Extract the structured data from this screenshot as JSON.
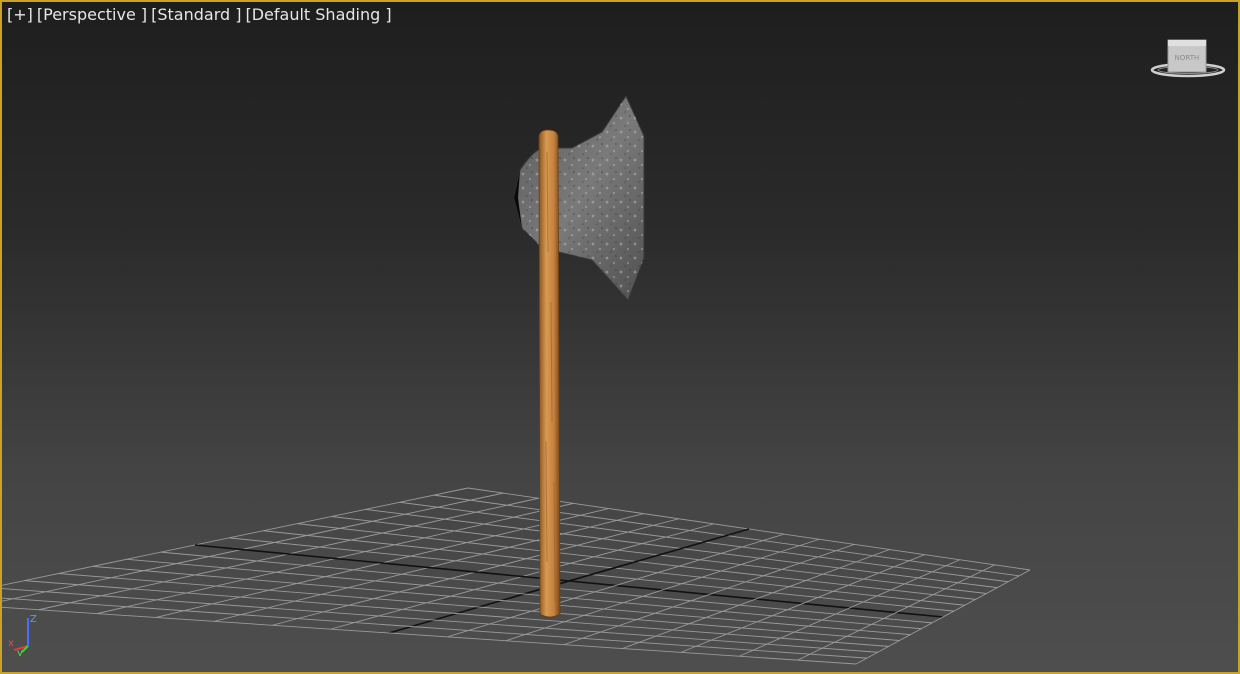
{
  "viewport": {
    "labels": {
      "menu": "[+]",
      "view": "[Perspective ]",
      "mode": "[Standard ]",
      "shading": "[Default Shading ]"
    },
    "active_border_color": "#c9a227",
    "viewcube": {
      "face_label": "NORTH",
      "icon": "viewcube-icon"
    },
    "axis_tripod": {
      "z_label": "Z",
      "x_label": "x",
      "y_label": "y"
    }
  },
  "scene": {
    "object": "axe",
    "handle_color": "#c8843c",
    "blade_color": "#6e6e6e",
    "grid_color": "#9a9a9a",
    "grid_axis_color": "#111111"
  }
}
